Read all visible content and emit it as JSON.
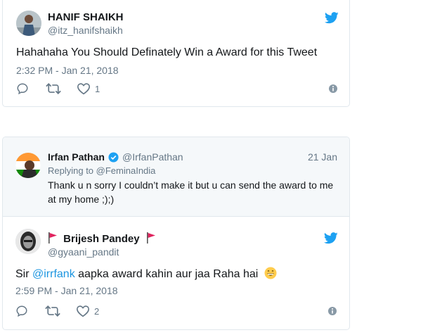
{
  "tweet1": {
    "name": "HANIF SHAIKH",
    "handle": "@itz_hanifshaikh",
    "text": "Hahahaha You Should Definately Win a Award for this Tweet",
    "time": "2:32 PM - Jan 21, 2018",
    "like_count": "1"
  },
  "quoted": {
    "name": "Irfan Pathan",
    "handle": "@IrfanPathan",
    "date": "21 Jan",
    "replying_label": "Replying to",
    "replying_to": "@FeminaIndia",
    "text_line1": "Thank u  n sorry I couldn’t make it but u can send the award to me",
    "text_line2": "at my home ;);)"
  },
  "tweet2": {
    "name": "Brijesh Pandey",
    "handle": "@gyaani_pandit",
    "text_prefix": "Sir ",
    "mention": "@irrfank",
    "text_suffix": " aapka award kahin aur jaa Raha hai",
    "time": "2:59 PM - Jan 21, 2018",
    "like_count": "2"
  },
  "colors": {
    "twitter_blue": "#1da1f2",
    "link_blue": "#1b95e0",
    "secondary_text": "#657786",
    "border": "#e1e8ed",
    "quote_bg": "#f5f8fa",
    "flag_red": "#e0245e"
  },
  "icons": [
    "twitter-bird-icon",
    "reply-icon",
    "retweet-icon",
    "like-icon",
    "info-icon",
    "verified-icon",
    "red-flag-icon",
    "grinning-emoji-icon"
  ]
}
